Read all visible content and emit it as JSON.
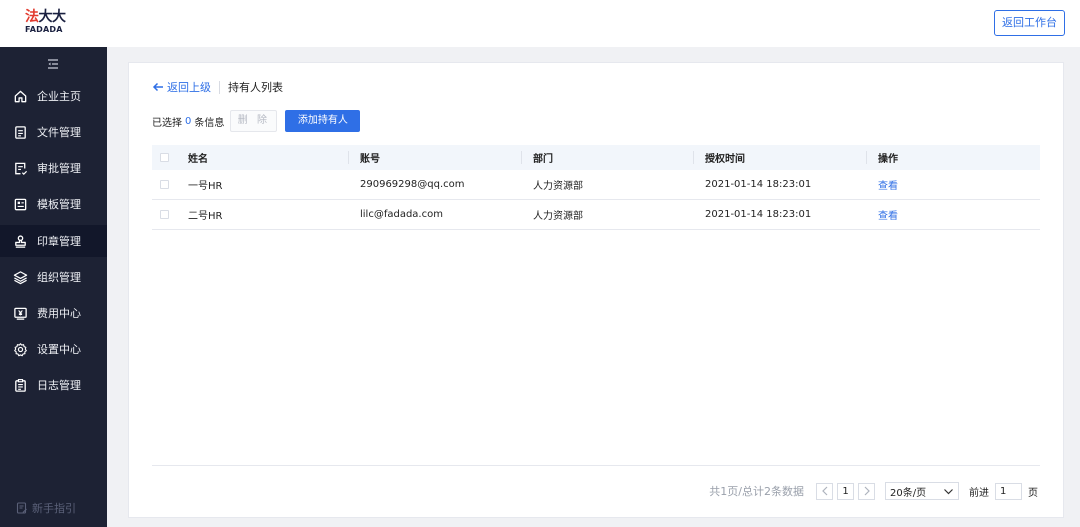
{
  "logo": {
    "cn_a": "法",
    "cn_b": "大大",
    "en": "FADADA"
  },
  "header": {
    "back_button": "返回工作台"
  },
  "sidebar": {
    "items": [
      {
        "label": "企业主页",
        "icon": "home-icon"
      },
      {
        "label": "文件管理",
        "icon": "document-icon"
      },
      {
        "label": "审批管理",
        "icon": "approval-icon"
      },
      {
        "label": "模板管理",
        "icon": "template-icon"
      },
      {
        "label": "印章管理",
        "icon": "stamp-icon",
        "active": true
      },
      {
        "label": "组织管理",
        "icon": "layers-icon"
      },
      {
        "label": "费用中心",
        "icon": "yuan-icon"
      },
      {
        "label": "设置中心",
        "icon": "gear-icon"
      },
      {
        "label": "日志管理",
        "icon": "clipboard-icon"
      }
    ],
    "guide": "新手指引"
  },
  "breadcrumb": {
    "back": "返回上级",
    "title": "持有人列表"
  },
  "toolbar": {
    "selected_prefix": "已选择",
    "selected_count": "0",
    "selected_suffix": "条信息",
    "delete": "删 除",
    "add": "添加持有人"
  },
  "table": {
    "columns": [
      "姓名",
      "账号",
      "部门",
      "授权时间",
      "操作"
    ],
    "rows": [
      {
        "name": "一号HR",
        "account": "290969298@qq.com",
        "dept": "人力资源部",
        "time": "2021-01-14 18:23:01",
        "action": "查看"
      },
      {
        "name": "二号HR",
        "account": "lilc@fadada.com",
        "dept": "人力资源部",
        "time": "2021-01-14 18:23:01",
        "action": "查看"
      }
    ]
  },
  "pagination": {
    "summary": "共1页/总计2条数据",
    "current_page": "1",
    "page_size": "20条/页",
    "goto_label": "前进",
    "goto_value": "1",
    "page_unit": "页"
  },
  "colors": {
    "accent": "#2f6fe6",
    "sidebar_bg": "#1d2234",
    "brand_red": "#e23a2e"
  }
}
